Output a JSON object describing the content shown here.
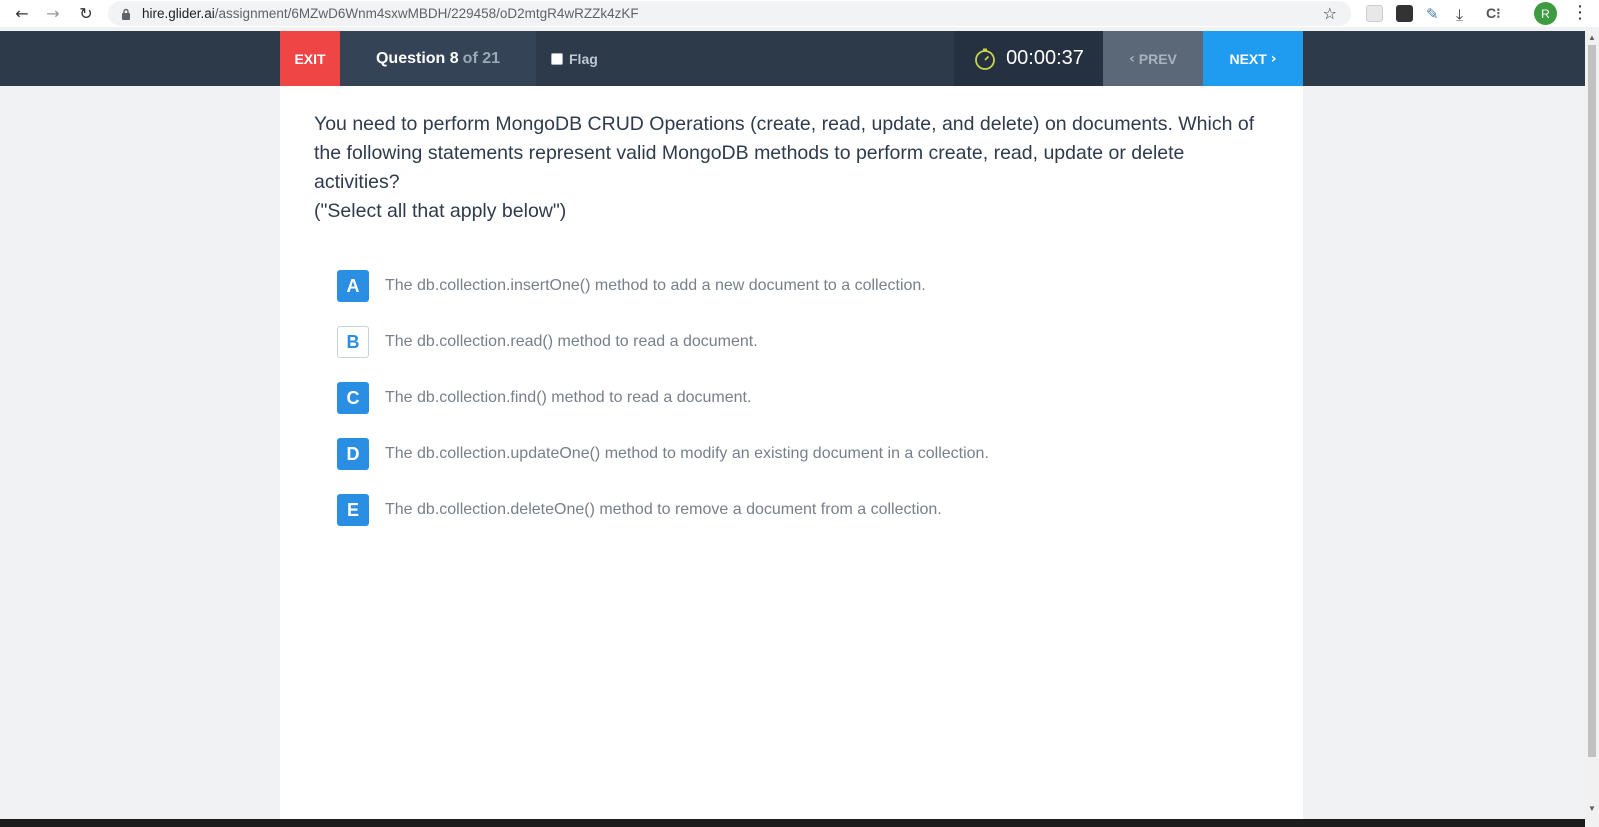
{
  "browser": {
    "url_host": "hire.glider.ai",
    "url_path": "/assignment/6MZwD6Wnm4sxwMBDH/229458/oD2mtgR4wRZZk4zKF",
    "avatar_letter": "R",
    "icons": [
      "back-arrow-icon",
      "forward-arrow-icon",
      "reload-icon",
      "lock-icon",
      "star-icon",
      "download-icon",
      "more-vert-icon"
    ]
  },
  "header": {
    "exit_label": "EXIT",
    "question_label": "Question",
    "question_number": "8",
    "question_total": "of 21",
    "flag_label": "Flag",
    "timer": "00:00:37",
    "prev_label": "PREV",
    "next_label": "NEXT"
  },
  "question": {
    "text": "You need to perform MongoDB CRUD Operations (create, read, update, and delete) on documents. Which of the following statements represent valid MongoDB methods to perform create, read, update or delete activities?",
    "instruction": "(\"Select all that apply below\")"
  },
  "options": [
    {
      "letter": "A",
      "text": "The db.collection.insertOne() method to add a new document to a collection.",
      "selected": true
    },
    {
      "letter": "B",
      "text": "The db.collection.read() method to read a document.",
      "selected": false
    },
    {
      "letter": "C",
      "text": "The db.collection.find() method to read a document.",
      "selected": true
    },
    {
      "letter": "D",
      "text": "The db.collection.updateOne() method to modify an existing document in a collection.",
      "selected": true
    },
    {
      "letter": "E",
      "text": "The db.collection.deleteOne() method to remove a document from a collection.",
      "selected": true
    }
  ],
  "colors": {
    "header_bg": "#2d3a4a",
    "exit_bg": "#f04545",
    "next_bg": "#1f9bf0",
    "prev_bg": "#5b6877",
    "option_selected": "#2a8ee3",
    "timer_icon": "#c9d34a"
  }
}
